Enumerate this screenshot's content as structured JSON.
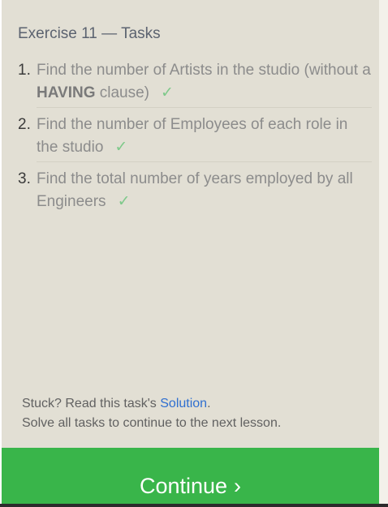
{
  "exercise": {
    "title": "Exercise 11 — Tasks"
  },
  "tasks": [
    {
      "number": "1.",
      "pre": "Find the number of Artists in the studio (without a ",
      "bold": "HAVING",
      "post": " clause)",
      "check": "✓"
    },
    {
      "number": "2.",
      "pre": "Find the number of Employees of each role in the studio",
      "bold": "",
      "post": "",
      "check": "✓"
    },
    {
      "number": "3.",
      "pre": "Find the total number of years employed by all Engineers",
      "bold": "",
      "post": "",
      "check": "✓"
    }
  ],
  "footer": {
    "stuck_prefix": "Stuck? Read this task's ",
    "solution_link": "Solution",
    "stuck_suffix": ".",
    "hint": "Solve all tasks to continue to the next lesson."
  },
  "continue_button": {
    "label": "Continue",
    "chevron": "›"
  },
  "colors": {
    "panel_background": "#e2dfd4",
    "continue_green": "#39b54a",
    "check_green": "#7ec98a",
    "link_blue": "#2f6fd0"
  }
}
